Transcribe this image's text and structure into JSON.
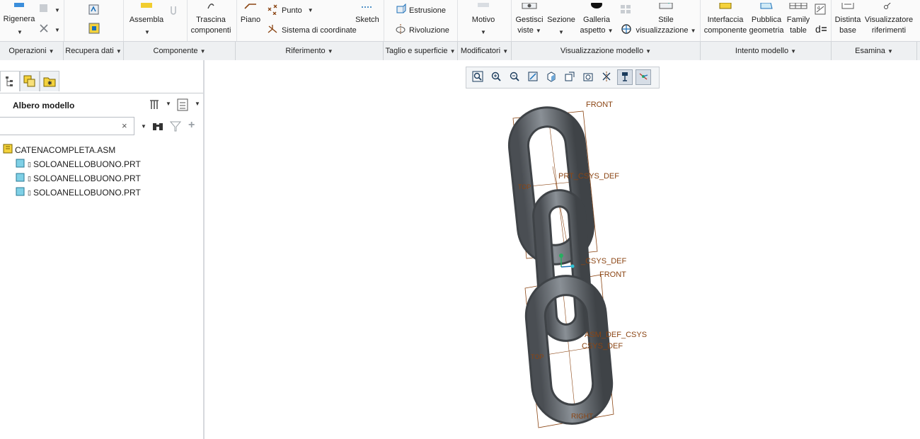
{
  "ribbon": {
    "buttons": {
      "regenerate": "Rigenera",
      "assemble": "Assembla",
      "drag_components": [
        "Trascina",
        "componenti"
      ],
      "plane": "Piano",
      "point": "Punto",
      "coord_system": "Sistema di coordinate",
      "sketch": "Sketch",
      "extrude": "Estrusione",
      "revolve": "Rivoluzione",
      "pattern": "Motivo",
      "manage_views": [
        "Gestisci",
        "viste"
      ],
      "section": "Sezione",
      "appearance_gallery": [
        "Galleria",
        "aspetto"
      ],
      "display_style": [
        "Stile",
        "visualizzazione"
      ],
      "component_interface": [
        "Interfaccia",
        "componente"
      ],
      "publish_geometry": [
        "Pubblica",
        "geometria"
      ],
      "family_table": [
        "Family",
        "table"
      ],
      "bill_of_materials": [
        "Distinta",
        "base"
      ],
      "reference_viewer": [
        "Visualizzatore",
        "riferimenti"
      ]
    },
    "groups": [
      "Operazioni",
      "Recupera dati",
      "Componente",
      "Riferimento",
      "Taglio e superficie",
      "Modificatori",
      "Visualizzazione modello",
      "Intento modello",
      "Esamina"
    ]
  },
  "navigator": {
    "title": "Albero modello",
    "search": {
      "value": "",
      "placeholder": ""
    },
    "tree": [
      {
        "name": "CATENACOMPLETA.ASM",
        "type": "assembly"
      },
      {
        "name": "SOLOANELLOBUONO.PRT",
        "type": "part"
      },
      {
        "name": "SOLOANELLOBUONO.PRT",
        "type": "part"
      },
      {
        "name": "SOLOANELLOBUONO.PRT",
        "type": "part"
      }
    ]
  },
  "viewport": {
    "datum_labels": {
      "front_top": "FRONT",
      "prt_csys_1": "PRT_CSYS_DEF",
      "csys_mid": "_CSYS_DEF",
      "front_mid": "FRONT",
      "asm_def_csys": "ASM_DEF_CSYS",
      "prt_csys_2": "CSYS_DEF",
      "right_bottom": "RIGHT",
      "top_left": "TOP",
      "top_left_2": "TOP"
    }
  },
  "colors": {
    "ribbon_bg": "#fafafa",
    "group_bar_bg": "#eef0f2",
    "datum_color": "#8b4513",
    "link_color": "#5c6166",
    "accent_blue": "#1a6fb8"
  }
}
